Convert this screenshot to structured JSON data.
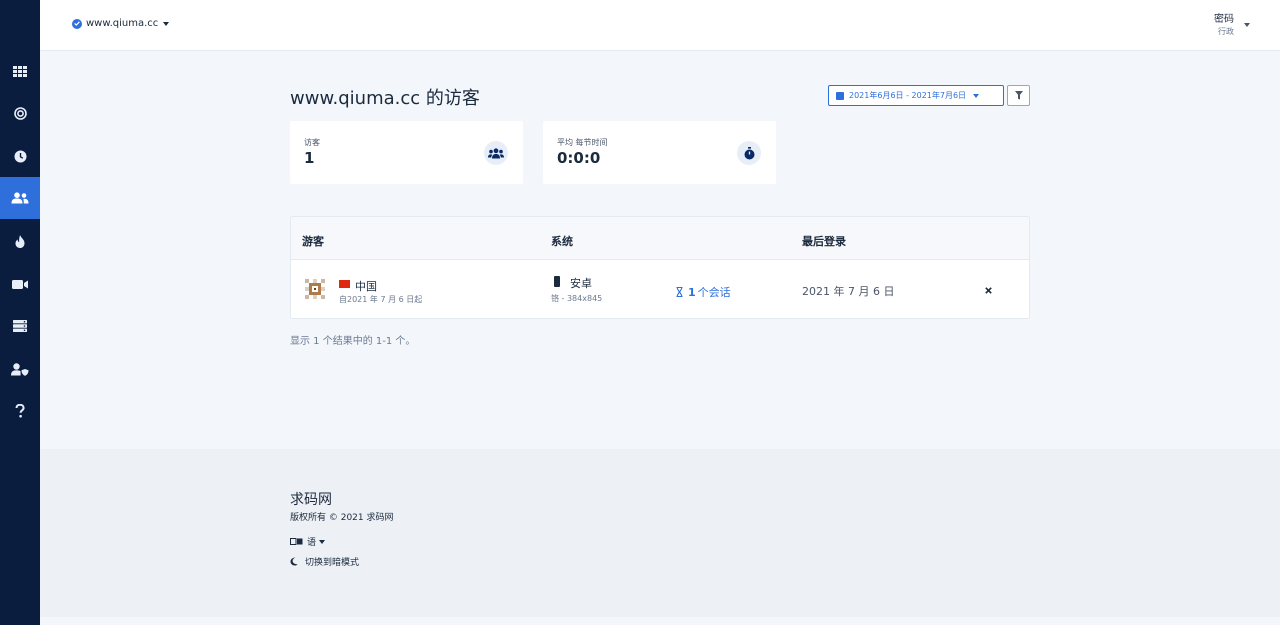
{
  "topbar": {
    "site": "www.qiuma.cc",
    "user_name": "密码",
    "user_role": "行政"
  },
  "sidebar": {
    "items": [
      {
        "name": "sidebar-item-websites",
        "icon": "grid-icon"
      },
      {
        "name": "sidebar-item-realtime",
        "icon": "target-icon"
      },
      {
        "name": "sidebar-item-history",
        "icon": "clock-icon"
      },
      {
        "name": "sidebar-item-visitors",
        "icon": "users-icon",
        "active": true
      },
      {
        "name": "sidebar-item-heatmaps",
        "icon": "fire-icon"
      },
      {
        "name": "sidebar-item-recordings",
        "icon": "video-icon"
      },
      {
        "name": "sidebar-item-data",
        "icon": "server-icon"
      },
      {
        "name": "sidebar-item-admin",
        "icon": "user-shield-icon"
      },
      {
        "name": "sidebar-item-help",
        "icon": "question-icon"
      }
    ]
  },
  "main": {
    "title": "www.qiuma.cc 的访客",
    "date_range": "2021年6月6日 - 2021年7月6日",
    "stats": [
      {
        "label": "访客",
        "value": "1",
        "icon": "users-icon"
      },
      {
        "label": "平均 每节时间",
        "value": "0:0:0",
        "icon": "stopwatch-icon"
      }
    ],
    "table": {
      "headers": [
        "游客",
        "系统",
        "最后登录"
      ],
      "rows": [
        {
          "country": "中国",
          "since": "自2021 年 7 月 6 日起",
          "os": "安卓",
          "os_detail": "铬 - 384x845",
          "sessions_count": "1",
          "sessions_label": "个会话",
          "last_login": "2021 年 7 月 6 日"
        }
      ]
    },
    "results_text": "显示 1 个结果中的 1-1 个。"
  },
  "footer": {
    "brand": "求码网",
    "copyright": "版权所有 © 2021 求码网",
    "language": "语",
    "dark_mode": "切换到暗模式"
  },
  "colors": {
    "sidebar_bg": "#0a1d3f",
    "accent": "#2f6fdc",
    "page_bg": "#f3f7fc",
    "footer_bg": "#edf1f6",
    "flag_red": "#de2910"
  }
}
